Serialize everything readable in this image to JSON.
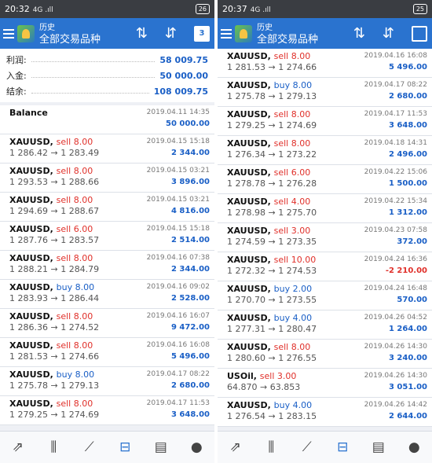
{
  "left": {
    "status": {
      "time": "20:32",
      "signal": "4G .ıll",
      "battery": "26"
    },
    "header": {
      "title": "历史",
      "subtitle": "全部交易品种",
      "calendar_day": "3"
    },
    "summary": [
      {
        "label": "利润:",
        "value": "58 009.75"
      },
      {
        "label": "入金:",
        "value": "50 000.00"
      },
      {
        "label": "结余:",
        "value": "108 009.75"
      }
    ],
    "balance": {
      "label": "Balance",
      "date": "2019.04.11 14:35",
      "amount": "50 000.00"
    },
    "trades": [
      {
        "symbol": "XAUUSD,",
        "side": "sell 8.00",
        "type": "sell",
        "prices": "1 286.42 → 1 283.49",
        "date": "2019.04.15 15:18",
        "amount": "2 344.00"
      },
      {
        "symbol": "XAUUSD,",
        "side": "sell 8.00",
        "type": "sell",
        "prices": "1 293.53 → 1 288.66",
        "date": "2019.04.15 03:21",
        "amount": "3 896.00"
      },
      {
        "symbol": "XAUUSD,",
        "side": "sell 8.00",
        "type": "sell",
        "prices": "1 294.69 → 1 288.67",
        "date": "2019.04.15 03:21",
        "amount": "4 816.00"
      },
      {
        "symbol": "XAUUSD,",
        "side": "sell 6.00",
        "type": "sell",
        "prices": "1 287.76 → 1 283.57",
        "date": "2019.04.15 15:18",
        "amount": "2 514.00"
      },
      {
        "symbol": "XAUUSD,",
        "side": "sell 8.00",
        "type": "sell",
        "prices": "1 288.21 → 1 284.79",
        "date": "2019.04.16 07:38",
        "amount": "2 344.00"
      },
      {
        "symbol": "XAUUSD,",
        "side": "buy 8.00",
        "type": "buy",
        "prices": "1 283.93 → 1 286.44",
        "date": "2019.04.16 09:02",
        "amount": "2 528.00"
      },
      {
        "symbol": "XAUUSD,",
        "side": "sell 8.00",
        "type": "sell",
        "prices": "1 286.36 → 1 274.52",
        "date": "2019.04.16 16:07",
        "amount": "9 472.00"
      },
      {
        "symbol": "XAUUSD,",
        "side": "sell 8.00",
        "type": "sell",
        "prices": "1 281.53 → 1 274.66",
        "date": "2019.04.16 16:08",
        "amount": "5 496.00"
      },
      {
        "symbol": "XAUUSD,",
        "side": "buy 8.00",
        "type": "buy",
        "prices": "1 275.78 → 1 279.13",
        "date": "2019.04.17 08:22",
        "amount": "2 680.00"
      },
      {
        "symbol": "XAUUSD,",
        "side": "sell 8.00",
        "type": "sell",
        "prices": "1 279.25 → 1 274.69",
        "date": "2019.04.17 11:53",
        "amount": "3 648.00"
      }
    ]
  },
  "right": {
    "status": {
      "time": "20:37",
      "signal": "4G .ıll",
      "battery": "25"
    },
    "header": {
      "title": "历史",
      "subtitle": "全部交易品种"
    },
    "trades": [
      {
        "symbol": "XAUUSD,",
        "side": "sell 8.00",
        "type": "sell",
        "prices": "1 281.53 → 1 274.66",
        "date": "2019.04.16 16:08",
        "amount": "5 496.00"
      },
      {
        "symbol": "XAUUSD,",
        "side": "buy 8.00",
        "type": "buy",
        "prices": "1 275.78 → 1 279.13",
        "date": "2019.04.17 08:22",
        "amount": "2 680.00"
      },
      {
        "symbol": "XAUUSD,",
        "side": "sell 8.00",
        "type": "sell",
        "prices": "1 279.25 → 1 274.69",
        "date": "2019.04.17 11:53",
        "amount": "3 648.00"
      },
      {
        "symbol": "XAUUSD,",
        "side": "sell 8.00",
        "type": "sell",
        "prices": "1 276.34 → 1 273.22",
        "date": "2019.04.18 14:31",
        "amount": "2 496.00"
      },
      {
        "symbol": "XAUUSD,",
        "side": "sell 6.00",
        "type": "sell",
        "prices": "1 278.78 → 1 276.28",
        "date": "2019.04.22 15:06",
        "amount": "1 500.00"
      },
      {
        "symbol": "XAUUSD,",
        "side": "sell 4.00",
        "type": "sell",
        "prices": "1 278.98 → 1 275.70",
        "date": "2019.04.22 15:34",
        "amount": "1 312.00"
      },
      {
        "symbol": "XAUUSD,",
        "side": "sell 3.00",
        "type": "sell",
        "prices": "1 274.59 → 1 273.35",
        "date": "2019.04.23 07:58",
        "amount": "372.00"
      },
      {
        "symbol": "XAUUSD,",
        "side": "sell 10.00",
        "type": "sell",
        "prices": "1 272.32 → 1 274.53",
        "date": "2019.04.24 16:36",
        "amount": "-2 210.00",
        "negative": true
      },
      {
        "symbol": "XAUUSD,",
        "side": "buy 2.00",
        "type": "buy",
        "prices": "1 270.70 → 1 273.55",
        "date": "2019.04.24 16:48",
        "amount": "570.00"
      },
      {
        "symbol": "XAUUSD,",
        "side": "buy 4.00",
        "type": "buy",
        "prices": "1 277.31 → 1 280.47",
        "date": "2019.04.26 04:52",
        "amount": "1 264.00"
      },
      {
        "symbol": "XAUUSD,",
        "side": "sell 8.00",
        "type": "sell",
        "prices": "1 280.60 → 1 276.55",
        "date": "2019.04.26 14:30",
        "amount": "3 240.00"
      },
      {
        "symbol": "USOil,",
        "side": "sell 3.00",
        "type": "sell",
        "prices": "64.870 → 63.853",
        "date": "2019.04.26 14:30",
        "amount": "3 051.00"
      },
      {
        "symbol": "XAUUSD,",
        "side": "buy 4.00",
        "type": "buy",
        "prices": "1 276.54 → 1 283.15",
        "date": "2019.04.26 14:42",
        "amount": "2 644.00"
      }
    ]
  },
  "nav": {
    "icons": [
      "trade-arrows-icon",
      "candlestick-chart-icon",
      "line-chart-icon",
      "history-inbox-icon",
      "news-icon",
      "chat-bubble-icon"
    ],
    "glyphs": [
      "⇗",
      "⫼",
      "⟋",
      "⊟",
      "▤",
      "●"
    ],
    "active_index": 3
  },
  "colors": {
    "accent": "#2a73cf",
    "sell": "#e0302a",
    "buy": "#1a5fc6",
    "value": "#1a5fc6"
  }
}
